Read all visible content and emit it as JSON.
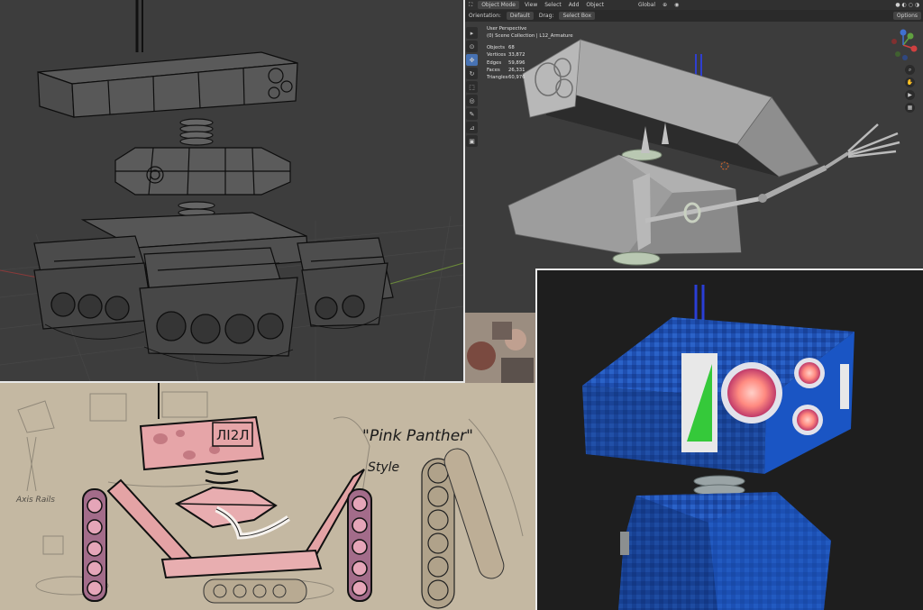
{
  "blender": {
    "header": {
      "mode": "Object Mode",
      "menus": [
        "View",
        "Select",
        "Add",
        "Object"
      ],
      "transform": "Global",
      "options": "Options"
    },
    "toolbar2": {
      "orientation_label": "Orientation:",
      "orientation_value": "Default",
      "drag_label": "Drag:",
      "drag_value": "Select Box"
    },
    "overlay": {
      "view": "User Perspective",
      "collection": "(0) Scene Collection | L12_Armature"
    },
    "stats": [
      {
        "label": "Objects",
        "value": "68"
      },
      {
        "label": "Vertices",
        "value": "33,872"
      },
      {
        "label": "Edges",
        "value": "59,896"
      },
      {
        "label": "Faces",
        "value": "26,331"
      },
      {
        "label": "Triangles",
        "value": "60,976"
      }
    ],
    "tools": [
      "select-cursor",
      "cursor",
      "move",
      "rotate",
      "scale",
      "transform",
      "annotate",
      "measure",
      "add-cube"
    ],
    "gizmo": {
      "x": "X",
      "y": "Y",
      "z": "Z"
    }
  },
  "sketch": {
    "badge": "ЛІ2Л",
    "title": "\"Pink Panther\"",
    "subtitle": "Style",
    "side_note": "Axis Rails"
  },
  "colors": {
    "blender_bg": "#3c3c3c",
    "wire_bg": "#3d3d3d",
    "render_blue": "#1f4fb0",
    "sketch_pink": "#e7a7a9",
    "lens_glow": "#ff8a80"
  }
}
